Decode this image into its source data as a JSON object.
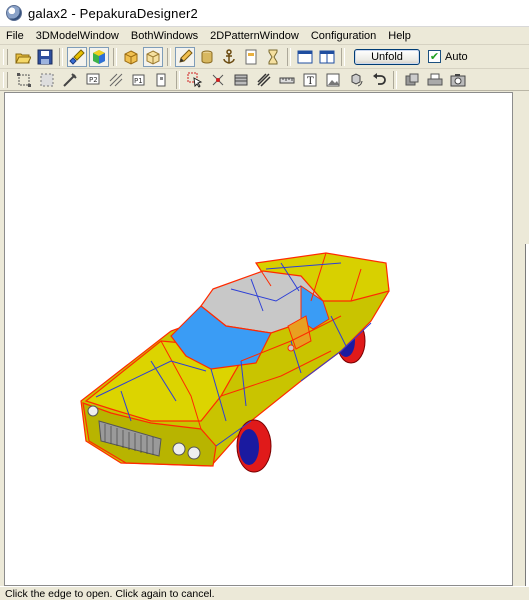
{
  "window": {
    "title": "galax2 - PepakuraDesigner2"
  },
  "menu": {
    "items": [
      "File",
      "3DModelWindow",
      "BothWindows",
      "2DPatternWindow",
      "Configuration",
      "Help"
    ]
  },
  "toolbar1": {
    "icons": [
      "open-folder-icon",
      "save-disk-icon",
      "paint-brush-icon",
      "color-cube-icon",
      "box-icon",
      "box-light-icon",
      "pencil-icon",
      "cylinder-icon",
      "anchor-icon",
      "page-icon",
      "hourglass-icon",
      "single-window-icon",
      "split-window-icon"
    ],
    "unfold_label": "Unfold",
    "auto_label": "Auto",
    "auto_checked": true
  },
  "toolbar2": {
    "icons": [
      "select-area-icon",
      "select-dashed-icon",
      "measure-icon",
      "sticker-icon",
      "hatch-icon",
      "flip-icon",
      "fold-icon",
      "pointer-icon",
      "move-vertex-icon",
      "edit-face-icon",
      "diagonal-lines-icon",
      "ruler-icon",
      "text-tool-icon",
      "image-tool-icon",
      "rotate-parts-icon",
      "undo-icon",
      "gear-settings-icon",
      "print-icon",
      "camera-icon"
    ]
  },
  "colors": {
    "car_body": "#c9c400",
    "car_body_light": "#e0d800",
    "roof_gray": "#c8c8c8",
    "glass_blue": "#3a9cf5",
    "fold_line_red": "#ff2a00",
    "fold_line_blue": "#2d3fd6",
    "wheel_red": "#e01a1a",
    "chrome": "#d8d8d8"
  },
  "status": {
    "text": "Click the edge to open. Click again to cancel."
  }
}
